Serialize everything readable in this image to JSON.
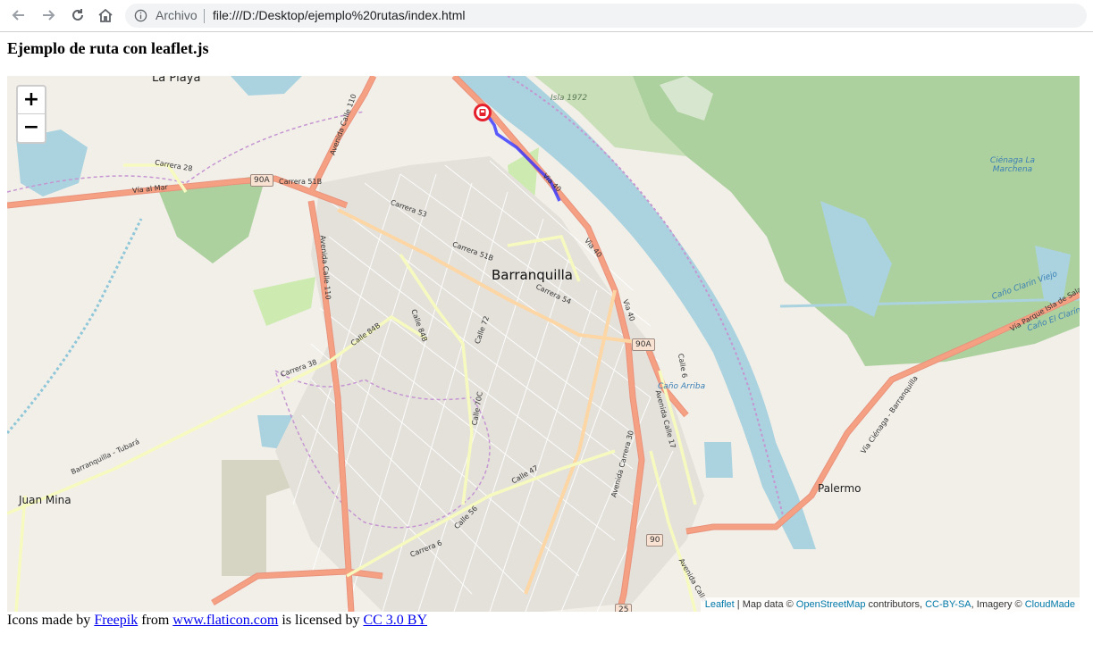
{
  "browser": {
    "security_label": "Archivo",
    "url": "file:///D:/Desktop/ejemplo%20rutas/index.html"
  },
  "page": {
    "title": "Ejemplo de ruta con leaflet.js"
  },
  "map": {
    "zoom_in": "+",
    "zoom_out": "−",
    "city_label": "Barranquilla",
    "place_labels": [
      "La Playa",
      "Juan Mina",
      "Palermo"
    ],
    "water_labels": [
      "Isla 1972",
      "Ciénaga La Marchena",
      "Caño Arriba",
      "Caño Clarín Viejo",
      "Caño El Clarín"
    ],
    "street_labels": [
      "Vía al Mar",
      "Carrera 28",
      "Carrera 51B",
      "Carrera 53",
      "Carrera 54",
      "Calle 84B",
      "Calle 72",
      "Calle 70C",
      "Calle 47",
      "Carrera 38",
      "Carrera 6",
      "Barranquilla - Tubará",
      "Avenida Calle 110",
      "Avenida Carrera 30",
      "Avenida Calle 17",
      "Via 40",
      "Calle 6",
      "Vía Parque Isla de Salamanca",
      "Vía Ciénaga - Barranquilla",
      "Avenida Calle 110 ",
      "Calle 56",
      "Avenida Calle"
    ],
    "road_shields": [
      "90A",
      "90A",
      "90",
      "25"
    ],
    "attribution": {
      "leaflet": "Leaflet",
      "sep": " | Map data © ",
      "osm": "OpenStreetMap",
      "contrib": " contributors, ",
      "license": "CC-BY-SA",
      "imagery": ", Imagery © ",
      "cloudmade": "CloudMade"
    },
    "colors": {
      "land": "#f2efe9",
      "water": "#aad3df",
      "park": "#add19e",
      "wetland": "#9cc28a",
      "primary_road": "#f6a083",
      "route": "#3333ff",
      "marker": "#e5202d"
    }
  },
  "footer": {
    "prefix": "Icons made by ",
    "freepik": "Freepik",
    "from": " from ",
    "flaticon": "www.flaticon.com",
    "licensed": " is licensed by ",
    "cc": "CC 3.0 BY"
  }
}
